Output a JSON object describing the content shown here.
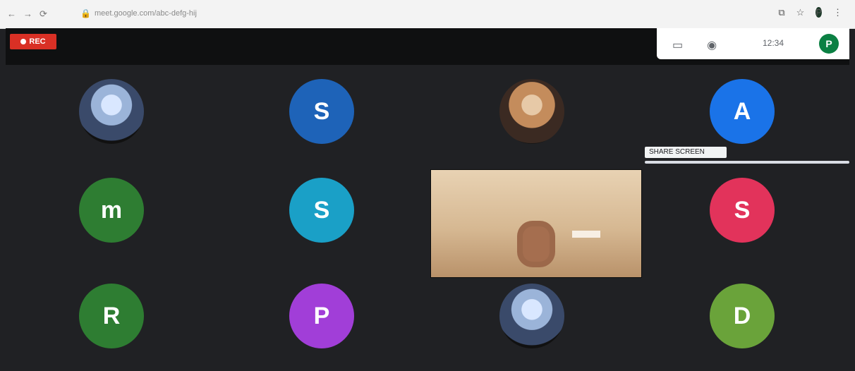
{
  "browser": {
    "url": "meet.google.com/abc-defg-hij",
    "icons": [
      "back-icon",
      "forward-icon",
      "refresh-icon",
      "lock-icon",
      "extensions-icon",
      "bookmark-icon",
      "profile-icon",
      "menu-icon"
    ],
    "profile_initial": "P"
  },
  "meet": {
    "recording_label": "REC",
    "top_panel": {
      "time": "12:34",
      "avatar_initial": "P"
    },
    "tiles": [
      {
        "type": "photo",
        "label": ""
      },
      {
        "type": "initial",
        "label": "S",
        "color": "#1e63b8"
      },
      {
        "type": "photo2",
        "label": ""
      },
      {
        "type": "initial",
        "label": "A",
        "color": "#1a73e8"
      },
      {
        "type": "initial",
        "label": "m",
        "color": "#2e7d32"
      },
      {
        "type": "initial",
        "label": "S",
        "color": "#1aa0c7"
      },
      {
        "type": "initial",
        "label": "S",
        "color": "#e2335b"
      },
      {
        "type": "initial",
        "label": "R",
        "color": "#2e7d32"
      },
      {
        "type": "initial",
        "label": "P",
        "color": "#a13ed8"
      },
      {
        "type": "photo",
        "label": ""
      },
      {
        "type": "initial",
        "label": "D",
        "color": "#6aa33a"
      }
    ],
    "tooltip_text": "SHARE SCREEN"
  }
}
